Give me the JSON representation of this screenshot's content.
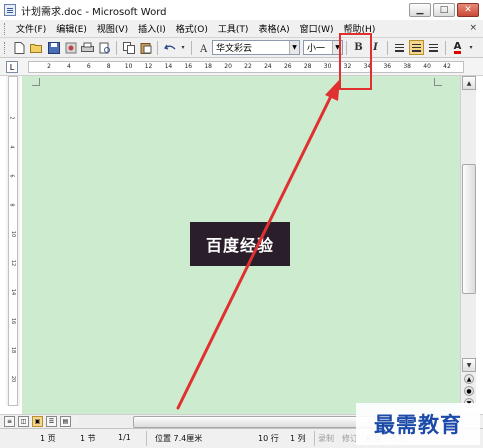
{
  "window": {
    "title": "计划需求.doc - Microsoft Word",
    "minimize_glyph": "▁",
    "maximize_glyph": "□",
    "close_glyph": "✕"
  },
  "menubar": {
    "items": [
      "文件(F)",
      "编辑(E)",
      "视图(V)",
      "插入(I)",
      "格式(O)",
      "工具(T)",
      "表格(A)",
      "窗口(W)",
      "帮助(H)"
    ],
    "close_glyph": "×"
  },
  "toolbar": {
    "font_name": "华文彩云",
    "font_size": "小一",
    "bold_label": "B",
    "italic_label": "I",
    "font_color_label": "A",
    "font_color": "#e00000",
    "active_color": "#f5d68a"
  },
  "ruler": {
    "tab_glyph": "L",
    "numbers": [
      "2",
      "4",
      "6",
      "8",
      "10",
      "12",
      "14",
      "16",
      "18",
      "20",
      "22",
      "24",
      "26",
      "28",
      "30",
      "32",
      "34",
      "36",
      "38",
      "40",
      "42"
    ]
  },
  "vruler": {
    "numbers": [
      "2",
      "4",
      "6",
      "8",
      "10",
      "12",
      "14",
      "16",
      "18",
      "20"
    ]
  },
  "document": {
    "background": "#cdeccf",
    "watermark_text": "百度经验"
  },
  "statusbar": {
    "page": "1 页",
    "section": "1 节",
    "page_of": "1/1",
    "position": "位置 7.4厘米",
    "line": "10 行",
    "column": "1 列",
    "record": "录制",
    "revision": "修订",
    "extend": "扩展",
    "overwrite": "改写"
  },
  "brand": {
    "text": "最需教育",
    "color": "#1b4aa8"
  },
  "annotation": {
    "color": "#e03030"
  }
}
